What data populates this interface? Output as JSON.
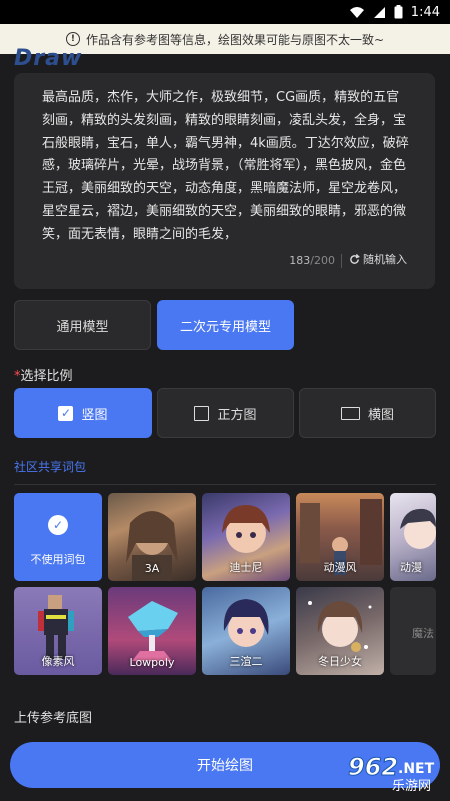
{
  "status": {
    "time": "1:44"
  },
  "notice": {
    "text": "作品含有参考图等信息，绘图效果可能与原图不太一致~"
  },
  "header": {
    "title_fragment": "Draw"
  },
  "prompt": {
    "text": "最高品质，杰作，大师之作，极致细节，CG画质，精致的五官刻画，精致的头发刻画，精致的眼睛刻画，凌乱头发，全身，宝石般眼睛，宝石，单人，霸气男神，4k画质。丁达尔效应，破碎感，玻璃碎片，光晕，战场背景，（常胜将军），黑色披风，金色王冠，美丽细致的天空，动态角度，黑暗魔法师，星空龙卷风，星空星云，褶边，美丽细致的天空，美丽细致的眼睛，邪恶的微笑，面无表情，眼睛之间的毛发，",
    "count": "183",
    "max": "/200",
    "random_label": "随机输入"
  },
  "models": {
    "general": "通用模型",
    "anime": "二次元专用模型",
    "selected": "anime"
  },
  "ratio": {
    "required_mark": "*",
    "label": "选择比例",
    "options": [
      "竖图",
      "正方图",
      "横图"
    ],
    "selected": "竖图"
  },
  "packs": {
    "title": "社区共享词包",
    "items": [
      {
        "label": "不使用词包",
        "selected": true
      },
      {
        "label": "3A"
      },
      {
        "label": "迪士尼"
      },
      {
        "label": "动漫风"
      },
      {
        "label": "动漫"
      },
      {
        "label": "像素风"
      },
      {
        "label": "Lowpoly"
      },
      {
        "label": "三渲二"
      },
      {
        "label": "冬日少女"
      },
      {
        "label": "魔法"
      }
    ]
  },
  "upload": {
    "label": "上传参考底图"
  },
  "start_button": {
    "label": "开始绘图"
  },
  "watermark": {
    "brand": "962",
    "sub": "乐游网",
    "suffix": ".NET"
  },
  "colors": {
    "accent": "#4a77f2",
    "background": "#1c1c1e",
    "card": "#2a2a2c"
  }
}
